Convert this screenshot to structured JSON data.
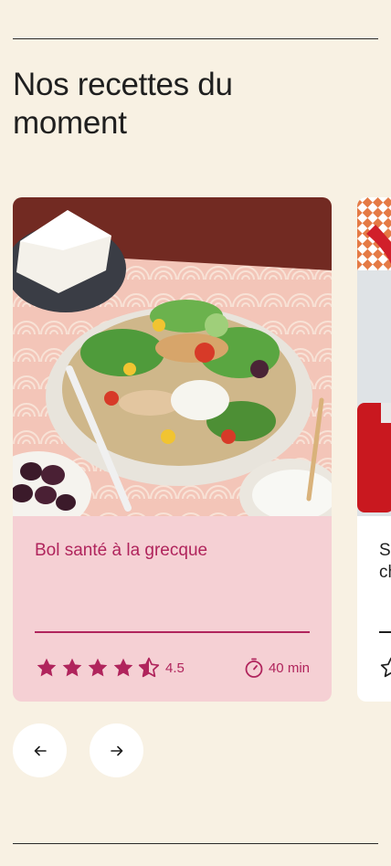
{
  "section": {
    "title": "Nos recettes du moment"
  },
  "cards": [
    {
      "title": "Bol santé à la grecque",
      "rating": "4.5",
      "time": "40 min",
      "image": "greek-salad-bowl-photo"
    },
    {
      "title": "S\nch",
      "image": "red-basket-ketchup-photo"
    }
  ],
  "nav": {
    "prev_icon": "arrow-left-icon",
    "next_icon": "arrow-right-icon"
  },
  "colors": {
    "background": "#f8f1e3",
    "card_pink": "#f5d0d4",
    "accent": "#b0245c"
  }
}
